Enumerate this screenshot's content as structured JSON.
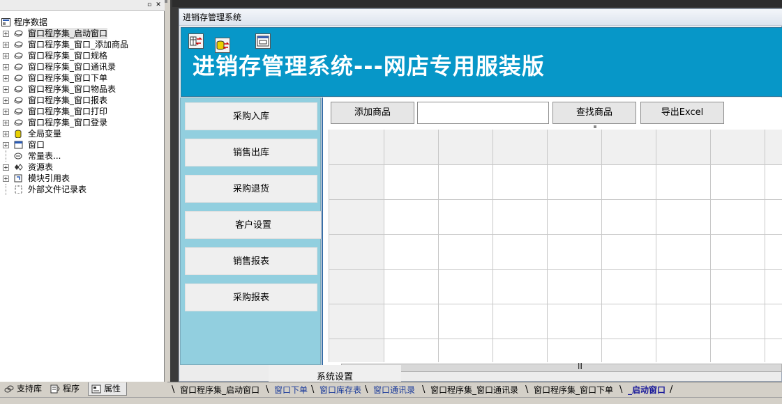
{
  "left_panel": {
    "tree": {
      "root": "程序数据",
      "items": [
        {
          "label": "窗口程序集_启动窗口",
          "icon": "window-assembly-icon",
          "selected": true
        },
        {
          "label": "窗口程序集_窗口_添加商品",
          "icon": "window-assembly-icon"
        },
        {
          "label": "窗口程序集_窗口规格",
          "icon": "window-assembly-icon"
        },
        {
          "label": "窗口程序集_窗口通讯录",
          "icon": "window-assembly-icon"
        },
        {
          "label": "窗口程序集_窗口下单",
          "icon": "window-assembly-icon"
        },
        {
          "label": "窗口程序集_窗口物品表",
          "icon": "window-assembly-icon"
        },
        {
          "label": "窗口程序集_窗口报表",
          "icon": "window-assembly-icon"
        },
        {
          "label": "窗口程序集_窗口打印",
          "icon": "window-assembly-icon"
        },
        {
          "label": "窗口程序集_窗口登录",
          "icon": "window-assembly-icon"
        },
        {
          "label": "全局变量",
          "icon": "global-variable-icon"
        },
        {
          "label": "窗口",
          "icon": "window-icon"
        },
        {
          "label": "常量表...",
          "icon": "constant-table-icon"
        },
        {
          "label": "资源表",
          "icon": "resource-table-icon"
        },
        {
          "label": "模块引用表",
          "icon": "module-reference-icon"
        },
        {
          "label": "外部文件记录表",
          "icon": "external-file-icon"
        }
      ]
    },
    "tabs": [
      "支持库",
      "程序",
      "属性"
    ]
  },
  "form": {
    "caption": "进销存管理系统",
    "banner_title": "进销存管理系统---网店专用服装版",
    "banner_color": "#0797c8",
    "sidebar_color": "#92cfdf",
    "sidebar_buttons": [
      "采购入库",
      "销售出库",
      "采购退货",
      "客户设置",
      "销售报表",
      "采购报表"
    ],
    "system_button": "系统设置",
    "toolbar": {
      "add_product": "添加商品",
      "search_value": "",
      "find_product": "查找商品",
      "export_excel": "导出Excel"
    },
    "grid": {
      "rows": 7,
      "cols": 9
    }
  },
  "bottom_tabs": [
    {
      "label": "窗口程序集_启动窗口",
      "style": "normal"
    },
    {
      "label": "窗口下单",
      "style": "blue"
    },
    {
      "label": "窗口库存表",
      "style": "blue"
    },
    {
      "label": "窗口通讯录",
      "style": "blue"
    },
    {
      "label": "窗口程序集_窗口通讯录",
      "style": "normal"
    },
    {
      "label": "窗口程序集_窗口下单",
      "style": "normal"
    },
    {
      "label": "_启动窗口",
      "style": "active"
    }
  ]
}
